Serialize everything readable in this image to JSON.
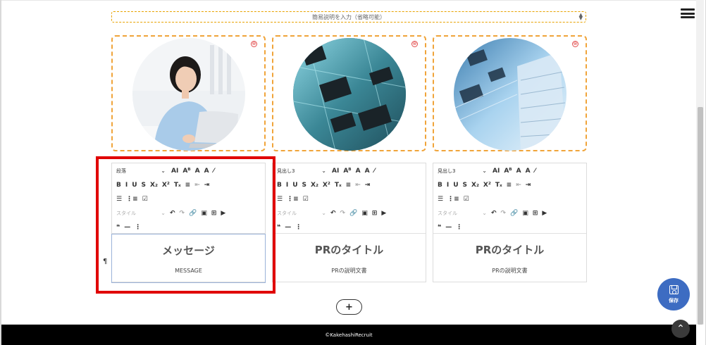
{
  "description_select": {
    "placeholder": "簡易説明を入力（省略可能）"
  },
  "image_boxes": [
    {
      "delete_glyph": "⊗"
    },
    {
      "delete_glyph": "⊗"
    },
    {
      "delete_glyph": "⊗"
    }
  ],
  "toolbar": {
    "format_labels": [
      "段落",
      "見出し3",
      "見出し3"
    ],
    "style_label": "スタイル",
    "font_size": "AI",
    "font_style": "Aᴮ",
    "font_color": "A",
    "bg_color": "A",
    "highlight": "⁄",
    "bold": "B",
    "italic": "I",
    "underline": "U",
    "strike": "S",
    "subscript": "X₂",
    "superscript": "X²",
    "clear": "Tₓ",
    "align": "≡",
    "outdent": "⇤",
    "indent": "⇥",
    "bullets": "☰",
    "numbers": "⋮≡",
    "todo": "☑",
    "undo": "↶",
    "redo": "↷",
    "link": "🔗",
    "image": "▣",
    "table": "⊞",
    "media": "▶",
    "quote": "❝",
    "hr": "—",
    "more": "⋮",
    "chevron": "⌄"
  },
  "cards": [
    {
      "title": "メッセージ",
      "subtitle": "MESSAGE"
    },
    {
      "title": "PRのタイトル",
      "subtitle": "PRの説明文書"
    },
    {
      "title": "PRのタイトル",
      "subtitle": "PRの説明文書"
    }
  ],
  "pilcrow": "¶",
  "add_button": "+",
  "footer": {
    "copyright": "©KakehashiRecruit"
  },
  "save_button": {
    "label": "保存"
  },
  "scroll_top": "⌃",
  "colors": {
    "accent": "#3d6cc2",
    "highlight_red": "#e00000",
    "dashed_orange": "#f0a43a"
  }
}
